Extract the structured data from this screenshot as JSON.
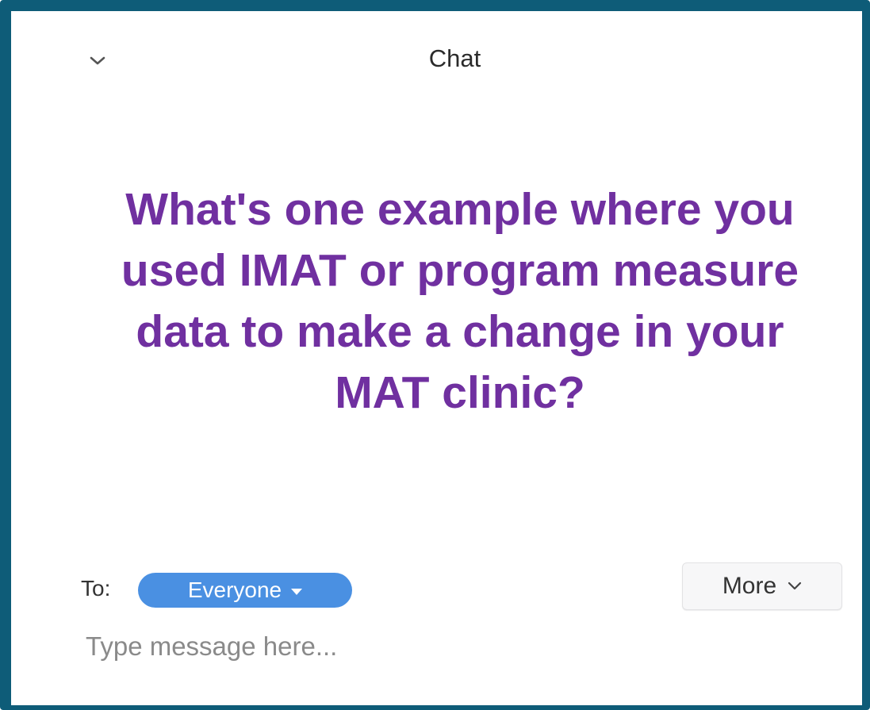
{
  "chat": {
    "title": "Chat",
    "question": "What's one example where you used IMAT or program measure data to make a change in your MAT clinic?",
    "to_label": "To:",
    "recipient": "Everyone",
    "more_label": "More",
    "input_placeholder": "Type message here..."
  },
  "icons": {
    "collapse": "chevron-down-icon",
    "recipient_dropdown": "caret-down-icon",
    "more_dropdown": "chevron-down-icon"
  },
  "colors": {
    "frame": "#0e5c78",
    "question_text": "#7030a0",
    "recipient_pill": "#4a90e2"
  }
}
